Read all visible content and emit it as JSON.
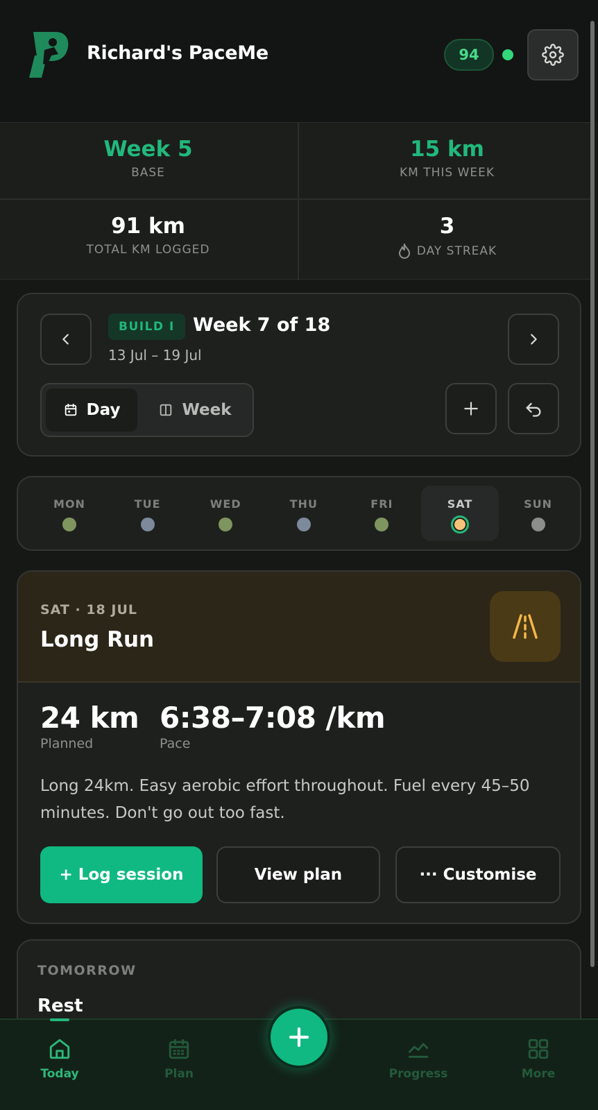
{
  "header": {
    "title": "Richard's PaceMe",
    "score": "94",
    "colors": {
      "brand": "#1f8a5b",
      "accent": "#22b87c",
      "status_online": "#34d67a"
    }
  },
  "stats": {
    "week": {
      "value": "Week 5",
      "label": "BASE"
    },
    "km_week": {
      "value": "15 km",
      "label": "KM THIS WEEK"
    },
    "total_km": {
      "value": "91 km",
      "label": "TOTAL KM LOGGED"
    },
    "streak": {
      "value": "3",
      "label": "DAY STREAK",
      "icon": "flame-icon"
    }
  },
  "week_nav": {
    "phase": "BUILD I",
    "title": "Week 7 of 18",
    "range": "13 Jul – 19 Jul",
    "view_day": "Day",
    "view_week": "Week",
    "selected_view": "Day"
  },
  "days": [
    {
      "label": "MON",
      "color": "#7f9560"
    },
    {
      "label": "TUE",
      "color": "#7d8a9c"
    },
    {
      "label": "WED",
      "color": "#7f9560"
    },
    {
      "label": "THU",
      "color": "#7d8a9c"
    },
    {
      "label": "FRI",
      "color": "#7f9560"
    },
    {
      "label": "SAT",
      "color": "#f7c378",
      "selected": true
    },
    {
      "label": "SUN",
      "color": "#8c8e8c"
    }
  ],
  "session": {
    "date": "SAT · 18 JUL",
    "type": "Long Run",
    "icon": "road-icon",
    "distance": "24 km",
    "distance_label": "Planned",
    "pace": "6:38–7:08 /km",
    "pace_label": "Pace",
    "notes": "Long 24km. Easy aerobic effort throughout. Fuel every 45–50 minutes. Don't go out too fast.",
    "log_button": "+ Log session",
    "view_button": "View plan",
    "customise_button": "··· Customise"
  },
  "tomorrow": {
    "label": "TOMORROW",
    "value": "Rest"
  },
  "nav": {
    "today": "Today",
    "plan": "Plan",
    "progress": "Progress",
    "more": "More",
    "active": "Today"
  }
}
